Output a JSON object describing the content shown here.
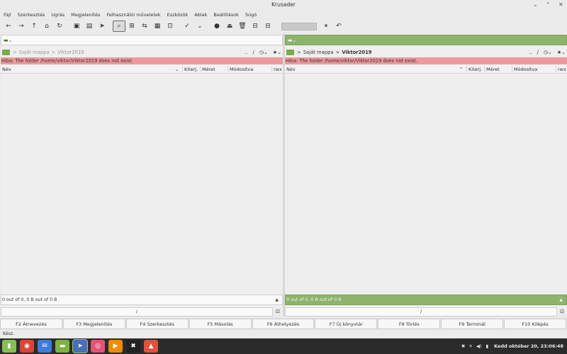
{
  "window": {
    "title": "Krusader",
    "controls": [
      "⌄",
      "⌃",
      "✕"
    ]
  },
  "menu": [
    "Fájl",
    "Szerkesztés",
    "Ugrás",
    "Megjelenítés",
    "Felhasználói műveletek",
    "Eszközök",
    "Ablak",
    "Beállítások",
    "Súgó"
  ],
  "toolbar": {
    "buttons": [
      {
        "name": "back-icon",
        "glyph": "←"
      },
      {
        "name": "forward-icon",
        "glyph": "→"
      },
      {
        "name": "up-icon",
        "glyph": "↑"
      },
      {
        "name": "home-icon",
        "glyph": "⌂"
      },
      {
        "name": "refresh-icon",
        "glyph": "↻"
      },
      {
        "name": "select-all-icon",
        "glyph": "▣"
      },
      {
        "name": "compare-icon",
        "glyph": "▤"
      },
      {
        "name": "pointer-icon",
        "glyph": "➤"
      },
      {
        "name": "search-icon",
        "glyph": "⌕",
        "active": true
      },
      {
        "name": "new-tab-icon",
        "glyph": "⊞"
      },
      {
        "name": "sync-icon",
        "glyph": "⇆"
      },
      {
        "name": "archive-icon",
        "glyph": "▦"
      },
      {
        "name": "pack-icon",
        "glyph": "⊡"
      },
      {
        "name": "check-icon",
        "glyph": "✓"
      },
      {
        "name": "check-menu-icon",
        "glyph": "⌄"
      },
      {
        "name": "globe-icon",
        "glyph": "●"
      },
      {
        "name": "mount-icon",
        "glyph": "⏏"
      },
      {
        "name": "trash-icon",
        "glyph": "🗑"
      },
      {
        "name": "split-left-icon",
        "glyph": "⊟"
      },
      {
        "name": "split-right-icon",
        "glyph": "⊟"
      }
    ],
    "after_progress": [
      {
        "name": "pause-icon",
        "glyph": "⏸"
      },
      {
        "name": "undo-icon",
        "glyph": "↶"
      }
    ]
  },
  "left_panel": {
    "crumbs": [
      "Saját mappa",
      "Viktor2019"
    ],
    "path_tools": [
      "..",
      "/",
      "◷⌄",
      "★⌄"
    ],
    "error": "Hiba: The folder /home/viktor/Viktor2019 does not exist.",
    "columns": [
      "Név",
      "Kiterj.",
      "Méret",
      "Módosítva",
      "rwx"
    ],
    "sort_indicator": "⌄",
    "status": "0 out of 0, 0 B out of 0 B",
    "status_arrow": "▲"
  },
  "right_panel": {
    "crumbs": [
      "Saját mappa",
      "Viktor2019"
    ],
    "path_tools": [
      "..",
      "/",
      "◷⌄",
      "★⌄"
    ],
    "error": "Hiba: The folder /home/viktor/Viktor2019 does not exist.",
    "columns": [
      "Név",
      "Kiterj.",
      "Méret",
      "Módosítva",
      "rwx"
    ],
    "sort_indicator": "⌃",
    "status": "0 out of 0, 0 B out of 0 B",
    "status_arrow": "▲"
  },
  "cmdline": {
    "left": "/",
    "right": "/"
  },
  "fkeys": [
    "F2 Átnevezés",
    "F3 Megjelenítés",
    "F4 Szerkesztés",
    "F5 Másolás",
    "F6 Áthelyezés",
    "F7 Új könyvtár",
    "F8 Törlés",
    "F9 Terminál",
    "F10 Kilépés"
  ],
  "statusbar": "Kész.",
  "taskbar": {
    "apps": [
      {
        "name": "mint-menu-icon",
        "glyph": "▮",
        "color": "#87c052"
      },
      {
        "name": "chrome-icon",
        "glyph": "◉",
        "color": "#db4437"
      },
      {
        "name": "mail-icon",
        "glyph": "✉",
        "color": "#3c7dd9"
      },
      {
        "name": "files-icon",
        "glyph": "▬",
        "color": "#7cb342"
      },
      {
        "name": "krusader-icon",
        "glyph": "➤",
        "color": "#4a6fb5",
        "active": true
      },
      {
        "name": "game-icon",
        "glyph": "◎",
        "color": "#e05575"
      },
      {
        "name": "vlc-icon",
        "glyph": "▶",
        "color": "#f28b00"
      },
      {
        "name": "xtools-icon",
        "glyph": "✖",
        "color": "#222222"
      },
      {
        "name": "image-viewer-icon",
        "glyph": "▲",
        "color": "#e0533b"
      }
    ],
    "tray": [
      "✖",
      "⌗",
      "◀)",
      "▮"
    ],
    "clock": "Kedd október 20, 23:06:48"
  }
}
